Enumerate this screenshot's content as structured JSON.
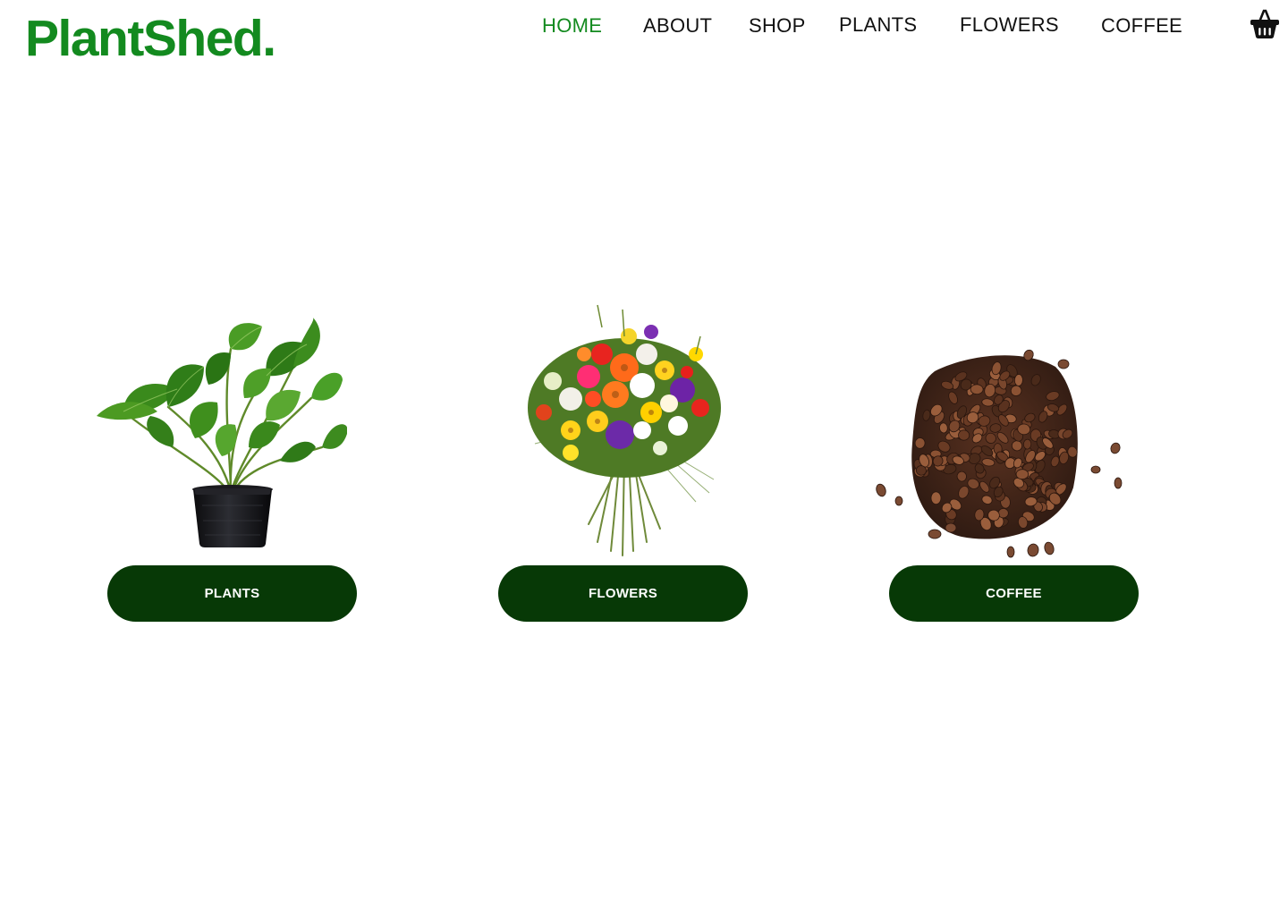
{
  "brand": {
    "logo_text": "PlantShed.",
    "accent_color": "#138a1f",
    "button_color": "#073906"
  },
  "nav": {
    "items": [
      {
        "label": "HOME",
        "active": true
      },
      {
        "label": "ABOUT",
        "active": false
      },
      {
        "label": "SHOP",
        "active": false
      },
      {
        "label": "PLANTS",
        "active": false
      },
      {
        "label": "FLOWERS",
        "active": false
      },
      {
        "label": "COFFEE",
        "active": false
      }
    ],
    "cart_icon": "shopping-basket-icon"
  },
  "categories": [
    {
      "label": "PLANTS",
      "image": "potted-plant-image"
    },
    {
      "label": "FLOWERS",
      "image": "flower-bouquet-image"
    },
    {
      "label": "COFFEE",
      "image": "coffee-beans-image"
    }
  ]
}
